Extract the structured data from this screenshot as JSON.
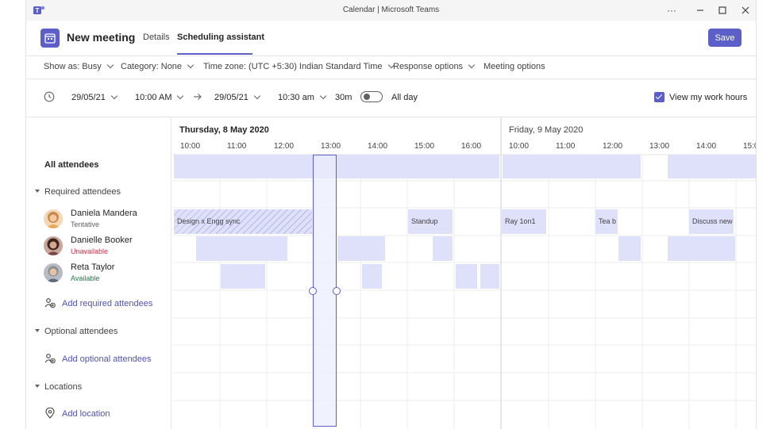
{
  "window": {
    "title": "Calendar | Microsoft Teams"
  },
  "header": {
    "title": "New meeting",
    "tabs": [
      {
        "label": "Details"
      },
      {
        "label": "Scheduling assistant"
      }
    ],
    "save_label": "Save"
  },
  "options": {
    "show_as": "Show as: Busy",
    "category": "Category: None",
    "time_zone": "Time zone: (UTC +5:30) Indian Standard Time",
    "response": "Response options",
    "meeting": "Meeting options"
  },
  "time": {
    "start_date": "29/05/21",
    "start_time": "10:00 AM",
    "end_date": "29/05/21",
    "end_time": "10:30 am",
    "duration": "30m",
    "all_day": "All day",
    "work_hours": "View my work hours"
  },
  "attendees": {
    "all": "All attendees",
    "required_header": "Required attendees",
    "people": [
      {
        "name": "Daniela Mandera",
        "status": "Tentative",
        "status_color": "#616161"
      },
      {
        "name": "Danielle Booker",
        "status": "Unavailable",
        "status_color": "#c4314b"
      },
      {
        "name": "Reta Taylor",
        "status": "Available",
        "status_color": "#237b4b"
      }
    ],
    "add_required": "Add required attendees",
    "optional_header": "Optional attendees",
    "add_optional": "Add optional attendees",
    "locations_header": "Locations",
    "add_location": "Add location"
  },
  "calendar": {
    "day1": "Thursday, 8 May 2020",
    "day2": "Friday, 9 May 2020",
    "hours1": [
      "10:00",
      "11:00",
      "12:00",
      "13:00",
      "14:00",
      "15:00",
      "16:00"
    ],
    "hours2": [
      "10:00",
      "11:00",
      "12:00",
      "13:00",
      "14:00",
      "15:00"
    ],
    "events": {
      "design": "Design x Engg sync",
      "standup": "Standup",
      "ray": "Ray 1on1",
      "tea": "Tea b",
      "discuss": "Discuss new"
    }
  },
  "colors": {
    "accent": "#5b5fc7",
    "busy": "#dfe0fa"
  }
}
